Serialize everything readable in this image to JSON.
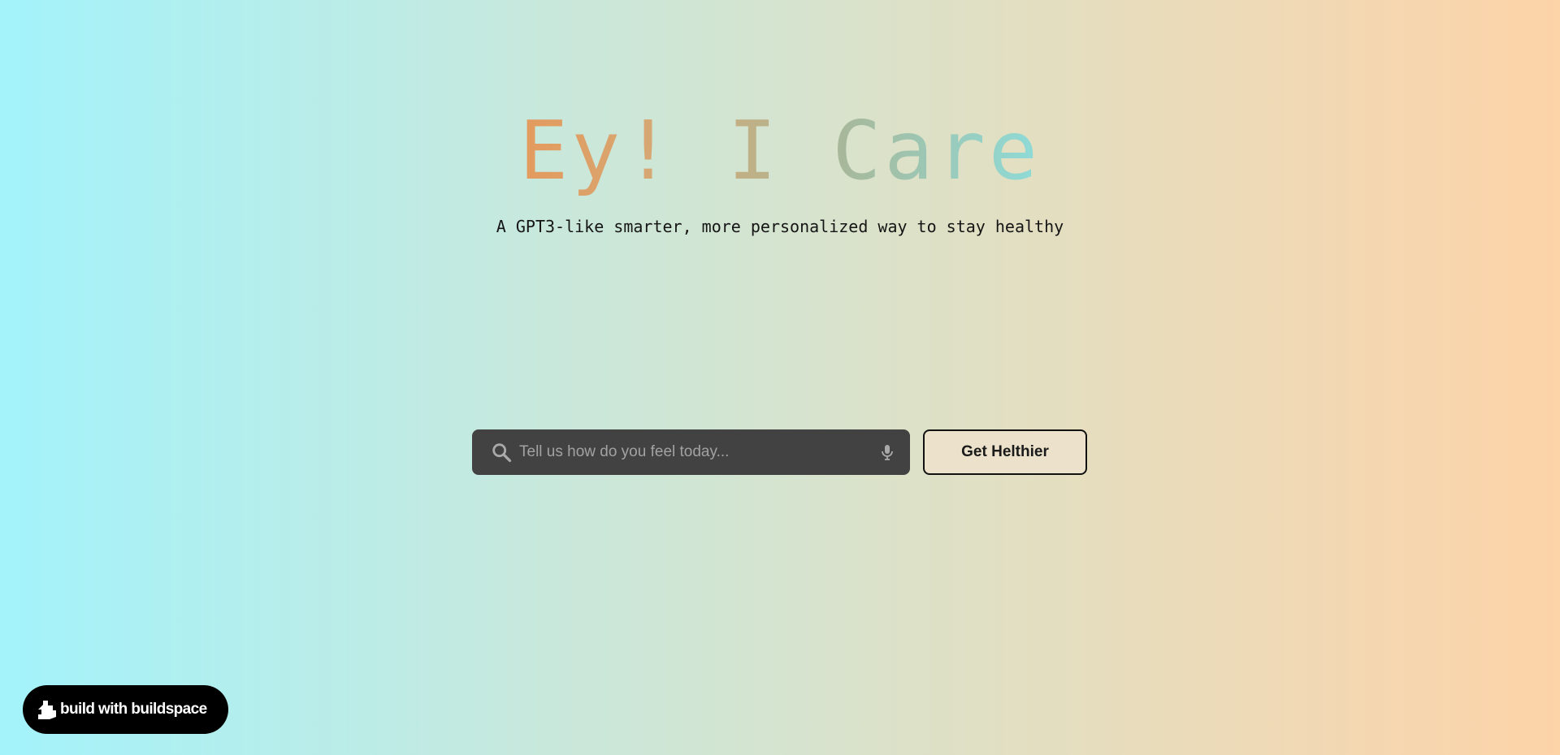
{
  "hero": {
    "title": "Ey! I Care",
    "subtitle": "A GPT3-like smarter, more personalized way to stay healthy"
  },
  "search": {
    "placeholder": "Tell us how do you feel today...",
    "value": "",
    "icon": "search-icon",
    "voice_icon": "mic-icon"
  },
  "cta": {
    "label": "Get Helthier"
  },
  "badge": {
    "label": "build with buildspace",
    "icon": "buildspace-logo"
  },
  "colors": {
    "background_left": "#a3f3fb",
    "background_right": "#fdd3a8",
    "title_gradient_start": "#e49a5d",
    "title_gradient_end": "#8edbd8",
    "search_bg": "#424242",
    "badge_bg": "#000000"
  }
}
